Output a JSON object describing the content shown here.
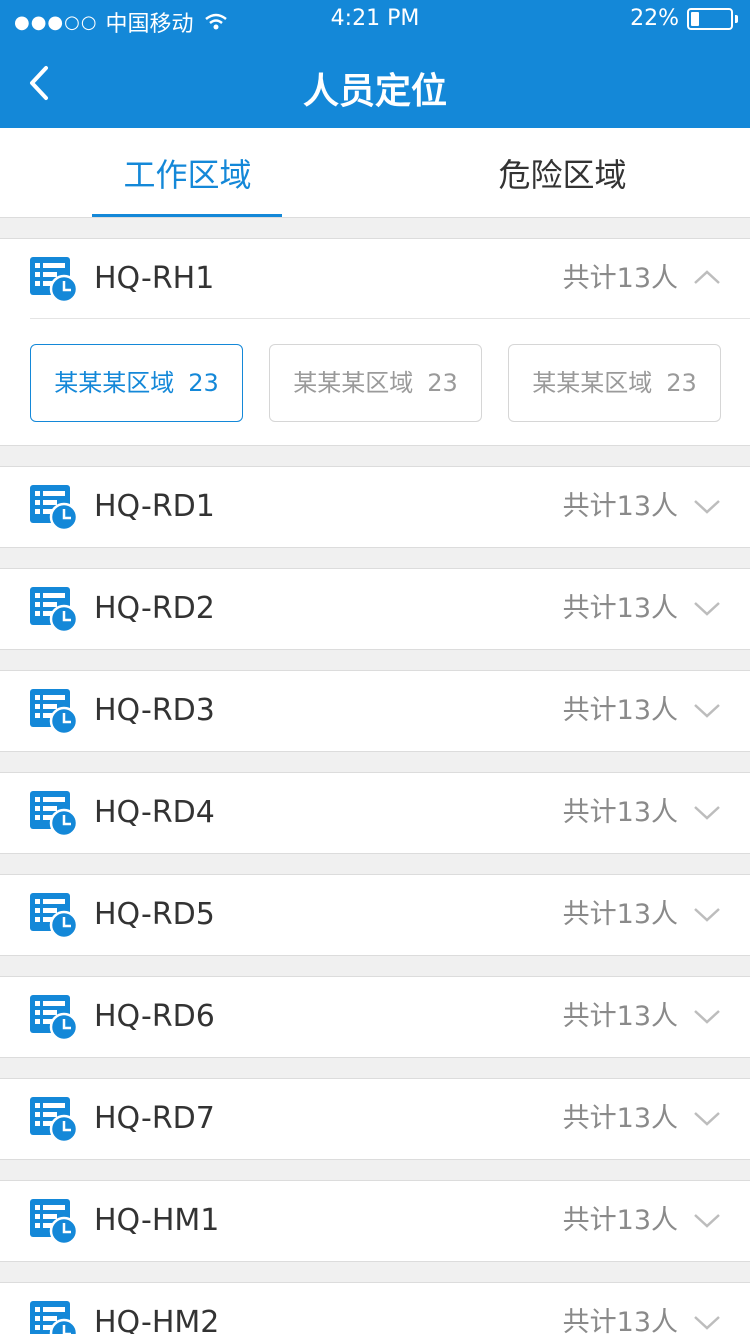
{
  "status": {
    "carrier": "中国移动",
    "time": "4:21 PM",
    "battery": "22%",
    "battery_level": 0.22
  },
  "nav": {
    "title": "人员定位",
    "back_icon": "chevron-left-icon"
  },
  "tabs": [
    {
      "label": "工作区域",
      "active": true
    },
    {
      "label": "危险区域",
      "active": false
    }
  ],
  "groups": [
    {
      "name": "HQ-RH1",
      "total": "共计13人",
      "expanded": true,
      "chips": [
        {
          "label": "某某某区域",
          "count": "23",
          "active": true
        },
        {
          "label": "某某某区域",
          "count": "23",
          "active": false
        },
        {
          "label": "某某某区域",
          "count": "23",
          "active": false
        }
      ]
    },
    {
      "name": "HQ-RD1",
      "total": "共计13人",
      "expanded": false
    },
    {
      "name": "HQ-RD2",
      "total": "共计13人",
      "expanded": false
    },
    {
      "name": "HQ-RD3",
      "total": "共计13人",
      "expanded": false
    },
    {
      "name": "HQ-RD4",
      "total": "共计13人",
      "expanded": false
    },
    {
      "name": "HQ-RD5",
      "total": "共计13人",
      "expanded": false
    },
    {
      "name": "HQ-RD6",
      "total": "共计13人",
      "expanded": false
    },
    {
      "name": "HQ-RD7",
      "total": "共计13人",
      "expanded": false
    },
    {
      "name": "HQ-HM1",
      "total": "共计13人",
      "expanded": false
    },
    {
      "name": "HQ-HM2",
      "total": "共计13人",
      "expanded": false
    }
  ],
  "colors": {
    "primary": "#1488d8",
    "background": "#f0f0f0",
    "muted_text": "#8a8a8a"
  }
}
